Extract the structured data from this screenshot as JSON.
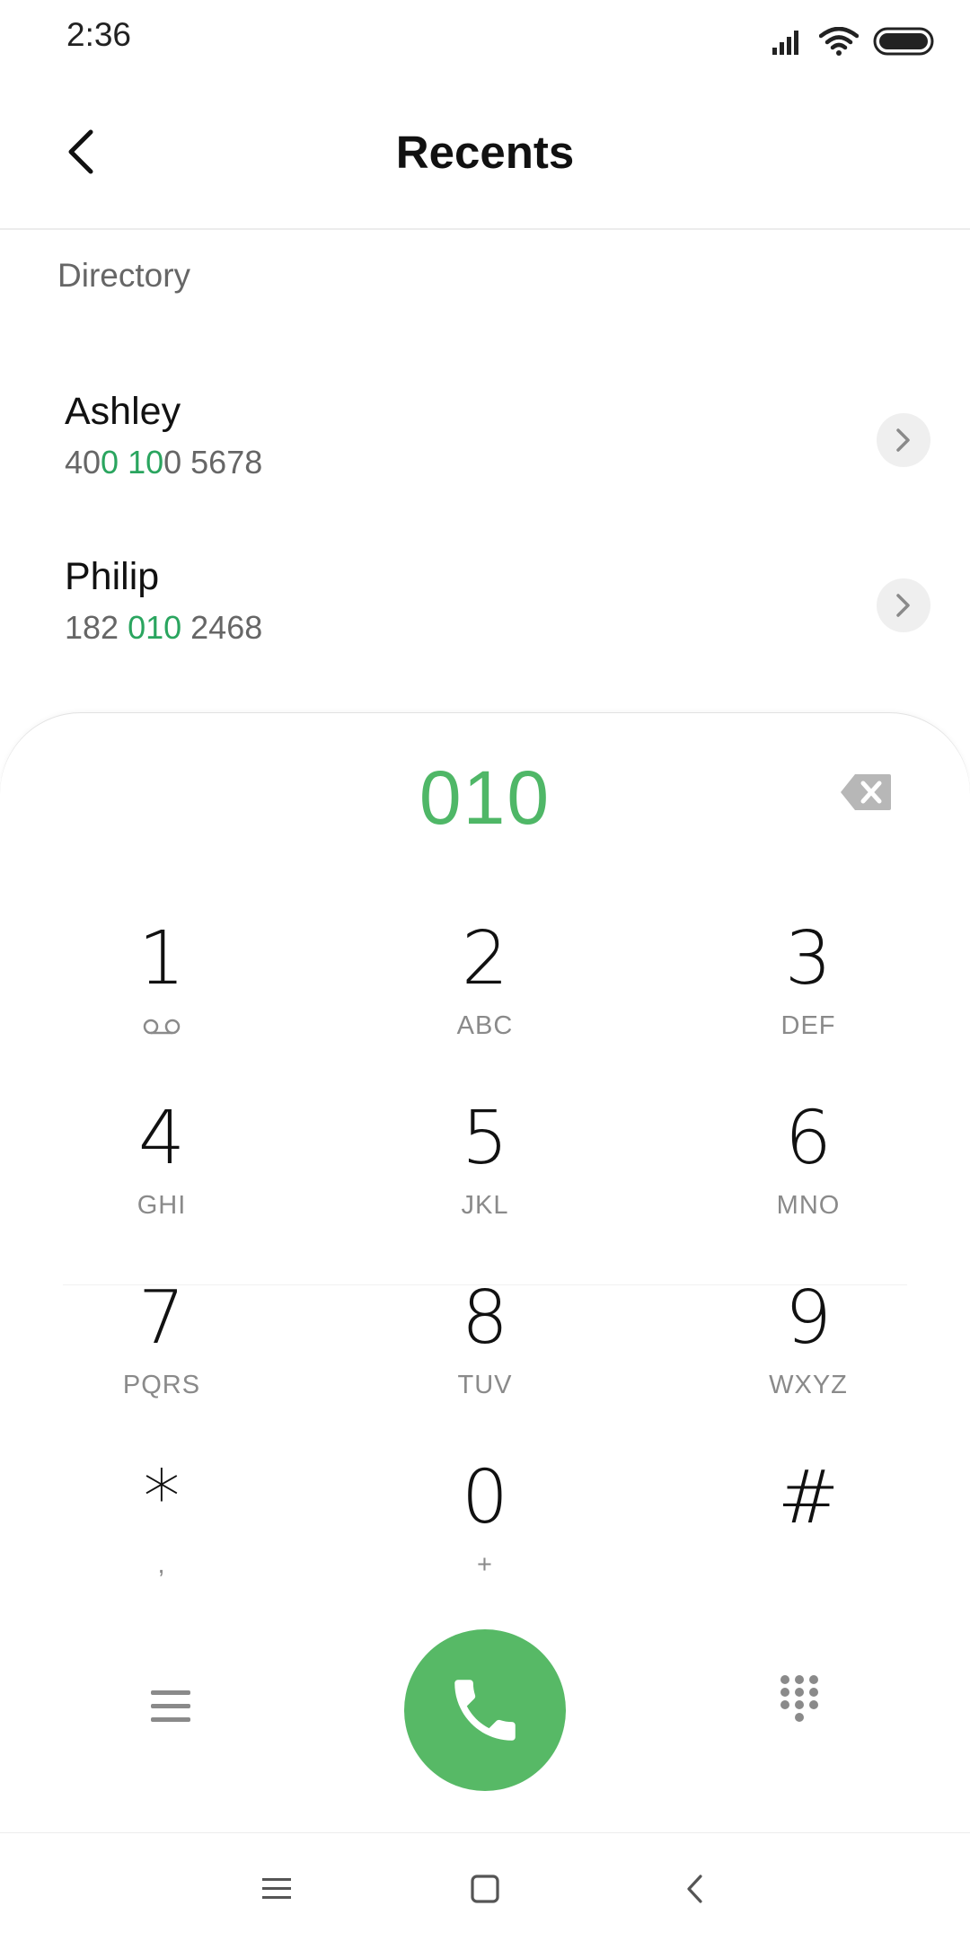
{
  "status_bar": {
    "time": "2:36",
    "icons": [
      "signal-icon",
      "wifi-icon",
      "battery-icon"
    ]
  },
  "header": {
    "title": "Recents",
    "back_icon": "chevron-left-icon"
  },
  "directory": {
    "label": "Directory",
    "contacts": [
      {
        "name": "Ashley",
        "number_parts": [
          {
            "text": "40",
            "highlight": false
          },
          {
            "text": "0 10",
            "highlight": true
          },
          {
            "text": "0 5678",
            "highlight": false
          }
        ]
      },
      {
        "name": "Philip",
        "number_parts": [
          {
            "text": "182 ",
            "highlight": false
          },
          {
            "text": "010",
            "highlight": true
          },
          {
            "text": " 2468",
            "highlight": false
          }
        ]
      }
    ]
  },
  "dialer": {
    "input": "010",
    "keys": [
      {
        "digit": "1",
        "letters": "",
        "icon": "voicemail-icon"
      },
      {
        "digit": "2",
        "letters": "ABC"
      },
      {
        "digit": "3",
        "letters": "DEF"
      },
      {
        "digit": "4",
        "letters": "GHI"
      },
      {
        "digit": "5",
        "letters": "JKL"
      },
      {
        "digit": "6",
        "letters": "MNO"
      },
      {
        "digit": "7",
        "letters": "PQRS"
      },
      {
        "digit": "8",
        "letters": "TUV"
      },
      {
        "digit": "9",
        "letters": "WXYZ"
      },
      {
        "digit": "*",
        "letters": ","
      },
      {
        "digit": "0",
        "letters": "+"
      },
      {
        "digit": "#",
        "letters": ""
      }
    ]
  },
  "colors": {
    "accent": "#4fb767",
    "highlight": "#2aa55f",
    "call_button": "#57b966"
  }
}
